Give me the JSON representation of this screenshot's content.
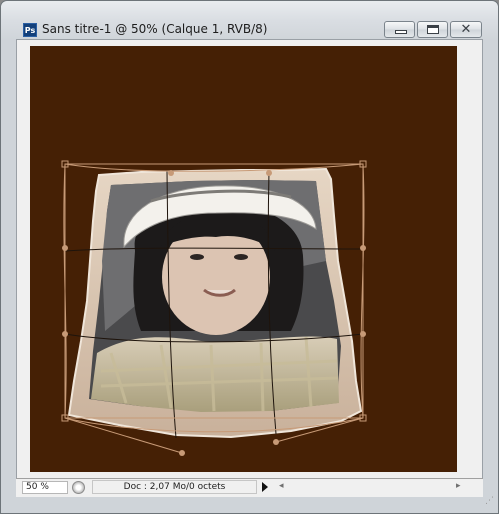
{
  "window": {
    "app_icon_text": "Ps",
    "title": "Sans titre-1 @ 50% (Calque 1, RVB/8)",
    "buttons": {
      "minimize": "minimize-icon",
      "maximize": "maximize-icon",
      "close": "close-icon"
    }
  },
  "canvas": {
    "background": "#452005",
    "layer": "Calque 1"
  },
  "status": {
    "zoom": "50 %",
    "doc_info": "Doc : 2,07 Mo/0 octets",
    "menu_arrow": "▶"
  },
  "scroll": {
    "left_arrow": "◂",
    "right_arrow": "▸"
  },
  "colors": {
    "warp_line": "#c79a77",
    "grid_line": "#1e140c"
  }
}
